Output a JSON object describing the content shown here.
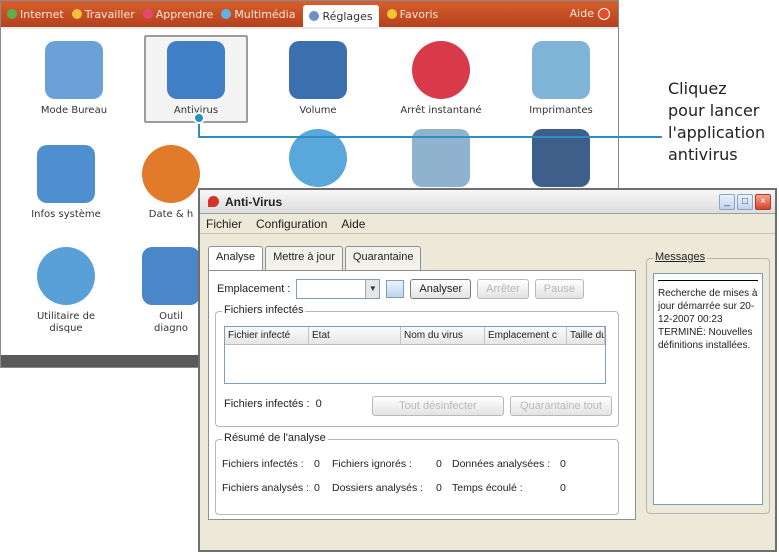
{
  "launcher": {
    "tabs": [
      {
        "label": "Internet",
        "icon": "globe-icon",
        "color": "#5bb04a"
      },
      {
        "label": "Travailler",
        "icon": "heart-icon",
        "color": "#f0c03a"
      },
      {
        "label": "Apprendre",
        "icon": "book-icon",
        "color": "#e34a70"
      },
      {
        "label": "Multimédia",
        "icon": "media-icon",
        "color": "#62b2e6"
      },
      {
        "label": "Réglages",
        "icon": "wrench-icon",
        "color": "#6f8fc8"
      },
      {
        "label": "Favoris",
        "icon": "star-icon",
        "color": "#f5c431"
      }
    ],
    "aide": "Aide",
    "apps": [
      {
        "label": "Mode Bureau",
        "icon": "monitor-icon",
        "color": "#6aa2d8"
      },
      {
        "label": "Antivirus",
        "icon": "shield-icon",
        "color": "#3f7fc6"
      },
      {
        "label": "Volume",
        "icon": "speaker-icon",
        "color": "#3a6fb0"
      },
      {
        "label": "Arrêt instantané",
        "icon": "power-icon",
        "color": "#d93a4a"
      },
      {
        "label": "Imprimantes",
        "icon": "printer-icon",
        "color": "#7fb4d6"
      },
      {
        "label": "Infos système",
        "icon": "laptop-info-icon",
        "color": "#4f8fd0"
      },
      {
        "label": "Date & h",
        "icon": "clock-icon",
        "color": "#e27a2c"
      },
      {
        "label": "",
        "icon": "user-icon",
        "color": "#5aa7dc"
      },
      {
        "label": "",
        "icon": "network-icon",
        "color": "#8fb3cf"
      },
      {
        "label": "",
        "icon": "disc-icon",
        "color": "#3d5f8a"
      },
      {
        "label": "Utilitaire de\ndisque",
        "icon": "disk-utility-icon",
        "color": "#5aa0d8"
      },
      {
        "label": "Outil\ndiagno",
        "icon": "tools-icon",
        "color": "#4b86c8"
      }
    ]
  },
  "callout": {
    "lines": [
      "Cliquez",
      "pour lancer",
      "l'application",
      "antivirus"
    ],
    "accent_color": "#2c8fc2"
  },
  "antivirus_window": {
    "title": "Anti-Virus",
    "menu": [
      "Fichier",
      "Configuration",
      "Aide"
    ],
    "tabs": [
      "Analyse",
      "Mettre à jour",
      "Quarantaine"
    ],
    "active_tab": "Analyse",
    "emplacement_label": "Emplacement :",
    "buttons": {
      "analyze": "Analyser",
      "stop": "Arrêter",
      "pause": "Pause"
    },
    "infected_group": "Fichiers infectés",
    "columns": [
      "Fichier infecté",
      "Etat",
      "Nom du virus",
      "Emplacement c",
      "Taille du"
    ],
    "infected_count_label": "Fichiers infectés :",
    "infected_count": "0",
    "buttons2": {
      "clean_all": "Tout désinfecter",
      "quarantine_all": "Quarantaine tout"
    },
    "summary_group": "Résumé de l'analyse",
    "summary_rows": [
      [
        "Fichiers infectés :",
        "0",
        "Fichiers ignorés :",
        "0",
        "Données analysées :",
        "0"
      ],
      [
        "Fichiers analysés :",
        "0",
        "Dossiers analysés :",
        "0",
        "Temps écoulé :",
        "0"
      ]
    ],
    "messages_label": "Messages",
    "messages_text": "Recherche de mises à jour démarrée sur 20-12-2007 00:23 TERMINÉ: Nouvelles définitions installées."
  }
}
